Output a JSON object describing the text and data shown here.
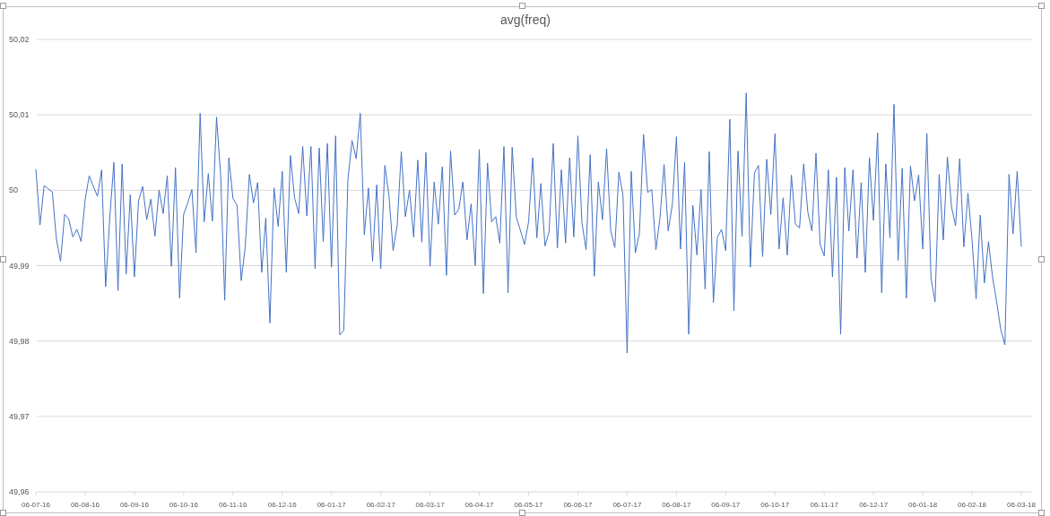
{
  "chart_data": {
    "type": "line",
    "title": "avg(freq)",
    "ylim": [
      49.96,
      50.02
    ],
    "yticks": [
      {
        "value": 49.96,
        "label": "49,96"
      },
      {
        "value": 49.97,
        "label": "49,97"
      },
      {
        "value": 49.98,
        "label": "49,98"
      },
      {
        "value": 49.99,
        "label": "49,99"
      },
      {
        "value": 50,
        "label": "50"
      },
      {
        "value": 50.01,
        "label": "50,01"
      },
      {
        "value": 50.02,
        "label": "50,02"
      }
    ],
    "grid": true,
    "categories": [
      "06-07-16",
      null,
      null,
      null,
      null,
      null,
      null,
      null,
      null,
      null,
      null,
      null,
      "06-08-16",
      null,
      null,
      null,
      null,
      null,
      null,
      null,
      null,
      null,
      null,
      null,
      "06-09-16",
      null,
      null,
      null,
      null,
      null,
      null,
      null,
      null,
      null,
      null,
      null,
      "06-10-16",
      null,
      null,
      null,
      null,
      null,
      null,
      null,
      null,
      null,
      null,
      null,
      "06-11-16",
      null,
      null,
      null,
      null,
      null,
      null,
      null,
      null,
      null,
      null,
      null,
      "06-12-16",
      null,
      null,
      null,
      null,
      null,
      null,
      null,
      null,
      null,
      null,
      null,
      "06-01-17",
      null,
      null,
      null,
      null,
      null,
      null,
      null,
      null,
      null,
      null,
      null,
      "06-02-17",
      null,
      null,
      null,
      null,
      null,
      null,
      null,
      null,
      null,
      null,
      null,
      "06-03-17",
      null,
      null,
      null,
      null,
      null,
      null,
      null,
      null,
      null,
      null,
      null,
      "06-04-17",
      null,
      null,
      null,
      null,
      null,
      null,
      null,
      null,
      null,
      null,
      null,
      "06-05-17",
      null,
      null,
      null,
      null,
      null,
      null,
      null,
      null,
      null,
      null,
      null,
      "06-06-17",
      null,
      null,
      null,
      null,
      null,
      null,
      null,
      null,
      null,
      null,
      null,
      "06-07-17",
      null,
      null,
      null,
      null,
      null,
      null,
      null,
      null,
      null,
      null,
      null,
      "06-08-17",
      null,
      null,
      null,
      null,
      null,
      null,
      null,
      null,
      null,
      null,
      null,
      "06-09-17",
      null,
      null,
      null,
      null,
      null,
      null,
      null,
      null,
      null,
      null,
      null,
      "06-10-17",
      null,
      null,
      null,
      null,
      null,
      null,
      null,
      null,
      null,
      null,
      null,
      "06-11-17",
      null,
      null,
      null,
      null,
      null,
      null,
      null,
      null,
      null,
      null,
      null,
      "06-12-17",
      null,
      null,
      null,
      null,
      null,
      null,
      null,
      null,
      null,
      null,
      null,
      "06-01-18",
      null,
      null,
      null,
      null,
      null,
      null,
      null,
      null,
      null,
      null,
      null,
      "06-02-18",
      null,
      null,
      null,
      null,
      null,
      null,
      null,
      null,
      null,
      null,
      null,
      "06-03-18"
    ],
    "series": [
      {
        "color": "#4472c4",
        "values": [
          50.0028,
          49.9954,
          50.0006,
          50.0002,
          49.9998,
          49.9935,
          49.9906,
          49.9968,
          49.9962,
          49.9938,
          49.9948,
          49.9932,
          49.9988,
          50.0019,
          50.0005,
          49.9992,
          50.0027,
          49.9872,
          49.9963,
          50.0037,
          49.9867,
          50.0035,
          49.9889,
          49.9994,
          49.9885,
          49.9986,
          50.0005,
          49.9961,
          49.9988,
          49.9939,
          50.0,
          49.9969,
          50.0019,
          49.9899,
          50.003,
          49.9857,
          49.9968,
          49.9983,
          50.0001,
          49.9917,
          50.0102,
          49.9958,
          50.0022,
          49.9959,
          50.0097,
          50.002,
          49.9854,
          50.0043,
          49.9989,
          49.998,
          49.988,
          49.9925,
          50.0021,
          49.9983,
          50.001,
          49.9891,
          49.9963,
          49.9824,
          50.0003,
          49.9952,
          50.0025,
          49.9891,
          50.0046,
          49.999,
          49.9969,
          50.0058,
          49.9966,
          50.0058,
          49.9896,
          50.0056,
          49.9932,
          50.0062,
          49.9898,
          50.0072,
          49.9808,
          49.9814,
          50.0014,
          50.0066,
          50.0042,
          50.0102,
          49.9941,
          50.0003,
          49.9906,
          50.0007,
          49.9896,
          50.0033,
          49.9993,
          49.992,
          49.9954,
          50.0051,
          49.9965,
          50.0,
          49.9938,
          50.004,
          49.9931,
          50.005,
          49.9899,
          50.0011,
          49.9955,
          50.0031,
          49.9887,
          50.0052,
          49.9967,
          49.9975,
          50.0011,
          49.9934,
          49.9982,
          49.99,
          50.0054,
          49.9863,
          50.0036,
          49.9958,
          49.9965,
          49.993,
          50.0058,
          49.9864,
          50.0057,
          49.9964,
          49.9947,
          49.9928,
          49.9958,
          50.0043,
          49.9937,
          50.0009,
          49.9926,
          49.9945,
          50.0062,
          49.9923,
          50.0027,
          49.993,
          50.0043,
          49.9938,
          50.0072,
          49.9957,
          49.9921,
          50.0047,
          49.9886,
          50.0011,
          49.9961,
          50.0055,
          49.9946,
          49.9924,
          50.0024,
          49.9993,
          49.9784,
          50.0025,
          49.9917,
          49.9943,
          50.0074,
          49.9997,
          50.0001,
          49.9921,
          49.9963,
          50.0034,
          49.9946,
          49.9981,
          50.0071,
          49.9922,
          50.0037,
          49.9809,
          49.998,
          49.9914,
          50.0001,
          49.9869,
          50.0051,
          49.9851,
          49.9938,
          49.9948,
          49.992,
          50.0094,
          49.984,
          50.0052,
          49.9939,
          50.0129,
          49.9898,
          50.0023,
          50.0033,
          49.9912,
          50.0041,
          49.9968,
          50.0075,
          49.9922,
          49.999,
          49.9914,
          50.002,
          49.9955,
          49.995,
          50.0035,
          49.9971,
          49.9946,
          50.0049,
          49.9928,
          49.9913,
          50.0027,
          49.9885,
          50.0017,
          49.9809,
          50.003,
          49.9946,
          50.0027,
          49.991,
          50.001,
          49.9891,
          50.0043,
          49.996,
          50.0076,
          49.9864,
          50.0035,
          49.9937,
          50.0114,
          49.9907,
          50.0029,
          49.9857,
          50.0032,
          49.9986,
          50.002,
          49.9922,
          50.0075,
          49.9883,
          49.9852,
          50.0021,
          49.9934,
          50.0044,
          49.9978,
          49.9953,
          50.0042,
          49.9925,
          49.9996,
          49.9935,
          49.9856,
          49.9967,
          49.9877,
          49.9932,
          49.9885,
          49.9852,
          49.9815,
          49.9795,
          50.0021,
          49.9942,
          50.0025,
          49.9925
        ]
      }
    ]
  }
}
